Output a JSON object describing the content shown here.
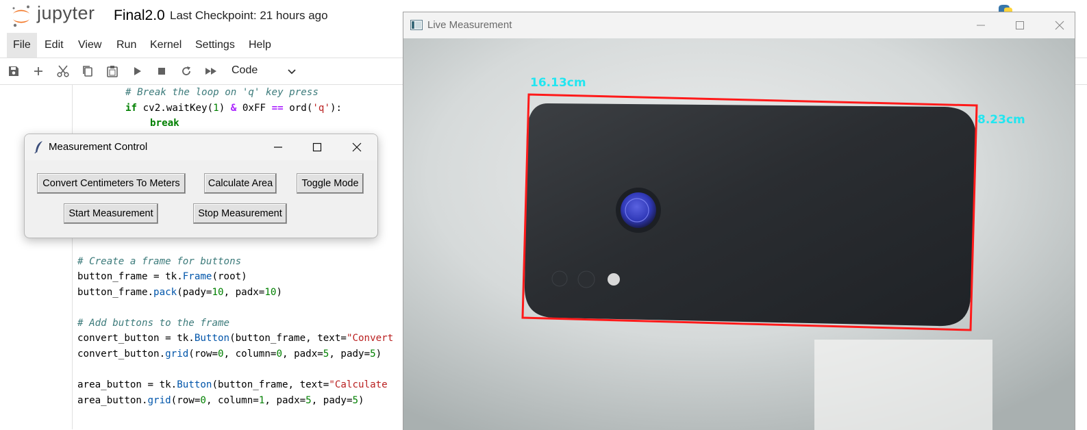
{
  "jupyter": {
    "logo_text": "jupyter",
    "notebook_name": "Final2.0",
    "checkpoint": "Last Checkpoint: 21 hours ago",
    "menu": [
      "File",
      "Edit",
      "View",
      "Run",
      "Kernel",
      "Settings",
      "Help"
    ],
    "active_menu": "File",
    "toolbar_icons": [
      "save-icon",
      "add-cell-icon",
      "cut-icon",
      "copy-icon",
      "paste-icon",
      "run-icon",
      "stop-icon",
      "restart-icon",
      "fast-forward-icon"
    ],
    "cell_type": "Code",
    "code_top": {
      "comment": "# Break the loop on 'q' key press",
      "if_line": {
        "kw": "if",
        "a": " cv2.waitKey(",
        "n1": "1",
        "b": ") ",
        "op1": "&",
        "c": " 0xFF ",
        "op2": "==",
        "d": " ord(",
        "s": "'q'",
        "e": "):"
      },
      "break_kw": "break"
    },
    "code_bottom": {
      "comment1": "# Create a frame for buttons",
      "l2a": "button_frame = tk.",
      "l2b": "Frame",
      "l2c": "(root)",
      "l3a": "button_frame.",
      "l3b": "pack",
      "l3c": "(pady=",
      "l3n1": "10",
      "l3d": ", padx=",
      "l3n2": "10",
      "l3e": ")",
      "comment2": "# Add buttons to the frame",
      "l5a": "convert_button = tk.",
      "l5b": "Button",
      "l5c": "(button_frame, text=",
      "l5s": "\"Convert",
      "l6a": "convert_button.",
      "l6b": "grid",
      "l6c": "(row=",
      "l6n1": "0",
      "l6d": ", column=",
      "l6n2": "0",
      "l6e": ", padx=",
      "l6n3": "5",
      "l6f": ", pady=",
      "l6n4": "5",
      "l6g": ")",
      "l7a": "area_button = tk.",
      "l7b": "Button",
      "l7c": "(button_frame, text=",
      "l7s": "\"Calculate",
      "l8a": "area_button.",
      "l8b": "grid",
      "l8c": "(row=",
      "l8n1": "0",
      "l8d": ", column=",
      "l8n2": "1",
      "l8e": ", padx=",
      "l8n3": "5",
      "l8f": ", pady=",
      "l8n4": "5",
      "l8g": ")"
    }
  },
  "measurement_control": {
    "title": "Measurement Control",
    "buttons": {
      "convert": "Convert Centimeters To Meters",
      "area": "Calculate Area",
      "toggle": "Toggle Mode",
      "start": "Start Measurement",
      "stop": "Stop Measurement"
    }
  },
  "live_measurement": {
    "title": "Live Measurement",
    "width_label": "16.13cm",
    "height_label": "8.23cm",
    "box_color": "#ff1a1a",
    "label_color": "#22e6f0"
  }
}
